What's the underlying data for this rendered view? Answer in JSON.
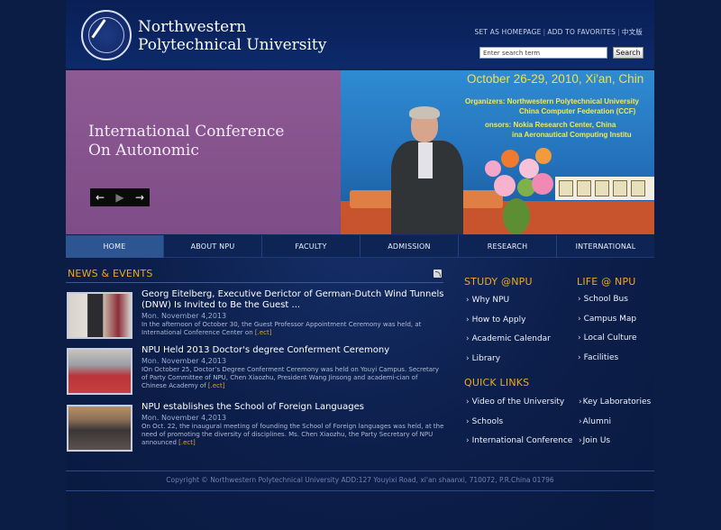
{
  "header": {
    "university_line1": "Northwestern",
    "university_line2": "Polytechnical University",
    "links": [
      "SET AS HOMEPAGE",
      "ADD TO FAVORITES",
      "中文版"
    ],
    "search_placeholder": "Enter search term",
    "search_button": "Search"
  },
  "banner": {
    "title_line1": "International Conference",
    "title_line2": "On Autonomic",
    "controls": {
      "prev": "←",
      "play": "▶",
      "next": "→"
    },
    "photo_heading": "October 26-29, 2010, Xi'an, Chin",
    "photo_sub1": "Organizers: Northwestern Polytechnical University",
    "photo_sub2": "China Computer Federation (CCF)",
    "photo_sub3": "onsors: Nokia Research Center, China",
    "photo_sub4": "ina Aeronautical Computing Institu"
  },
  "nav": {
    "items": [
      "HOME",
      "ABOUT NPU",
      "FACULTY",
      "ADMISSION",
      "RESEARCH",
      "INTERNATIONAL"
    ]
  },
  "news": {
    "title": "NEWS & EVENTS",
    "items": [
      {
        "title": "Georg Eitelberg, Executive Derictor of German-Dutch Wind Tunnels (DNW) Is Invited to Be the Guest ...",
        "date": "Mon. November 4,2013",
        "desc": "In the afternoon of October 30, the Guest Professor Appointment Ceremony was held, at International Conference Center on",
        "more": "[.ect]"
      },
      {
        "title": "NPU Held 2013 Doctor's degree Conferment Ceremony",
        "date": "Mon. November 4,2013",
        "desc": "IOn October 25, Doctor’s Degree Conferment Ceremony was held on Youyi Campus. Secretary of Party Committee of NPU, Chen Xiaozhu, President Wang Jinsong and academi-cian of Chinese Academy of",
        "more": "[.ect]"
      },
      {
        "title": "NPU establishes the School of Foreign Languages",
        "date": "Mon. November 4,2013",
        "desc": "On Oct. 22, the inaugural meeting of founding the School of Foreign languages was held, at the need of promoting the diversity of disciplines. Ms. Chen Xiaozhu, the Party Secretary of NPU announced",
        "more": "[.ect]"
      }
    ]
  },
  "study": {
    "title": "STUDY @NPU",
    "items": [
      "Why NPU",
      "How to Apply",
      "Academic Calendar",
      "Library"
    ]
  },
  "life": {
    "title": "LIFE @ NPU",
    "items": [
      "School Bus",
      "Campus Map",
      "Local Culture",
      "Facilities"
    ]
  },
  "quick_links": {
    "title": "QUICK LINKS",
    "left": [
      "Video of the University",
      "Schools",
      "International Conference"
    ],
    "right": [
      "Key Laboratories",
      "Alumni",
      "Join Us"
    ]
  },
  "footer": {
    "copyright": "Copyright © Northwestern Polytechnical University ADD:127 Youyixi Road, xi'an shaanxi, 710072, P.R.China 01796"
  },
  "colors": {
    "background": "#0d1f4a",
    "accent_orange": "#f0a81e",
    "nav_active": "#2d5592",
    "banner_purple": "#8e5a95"
  }
}
